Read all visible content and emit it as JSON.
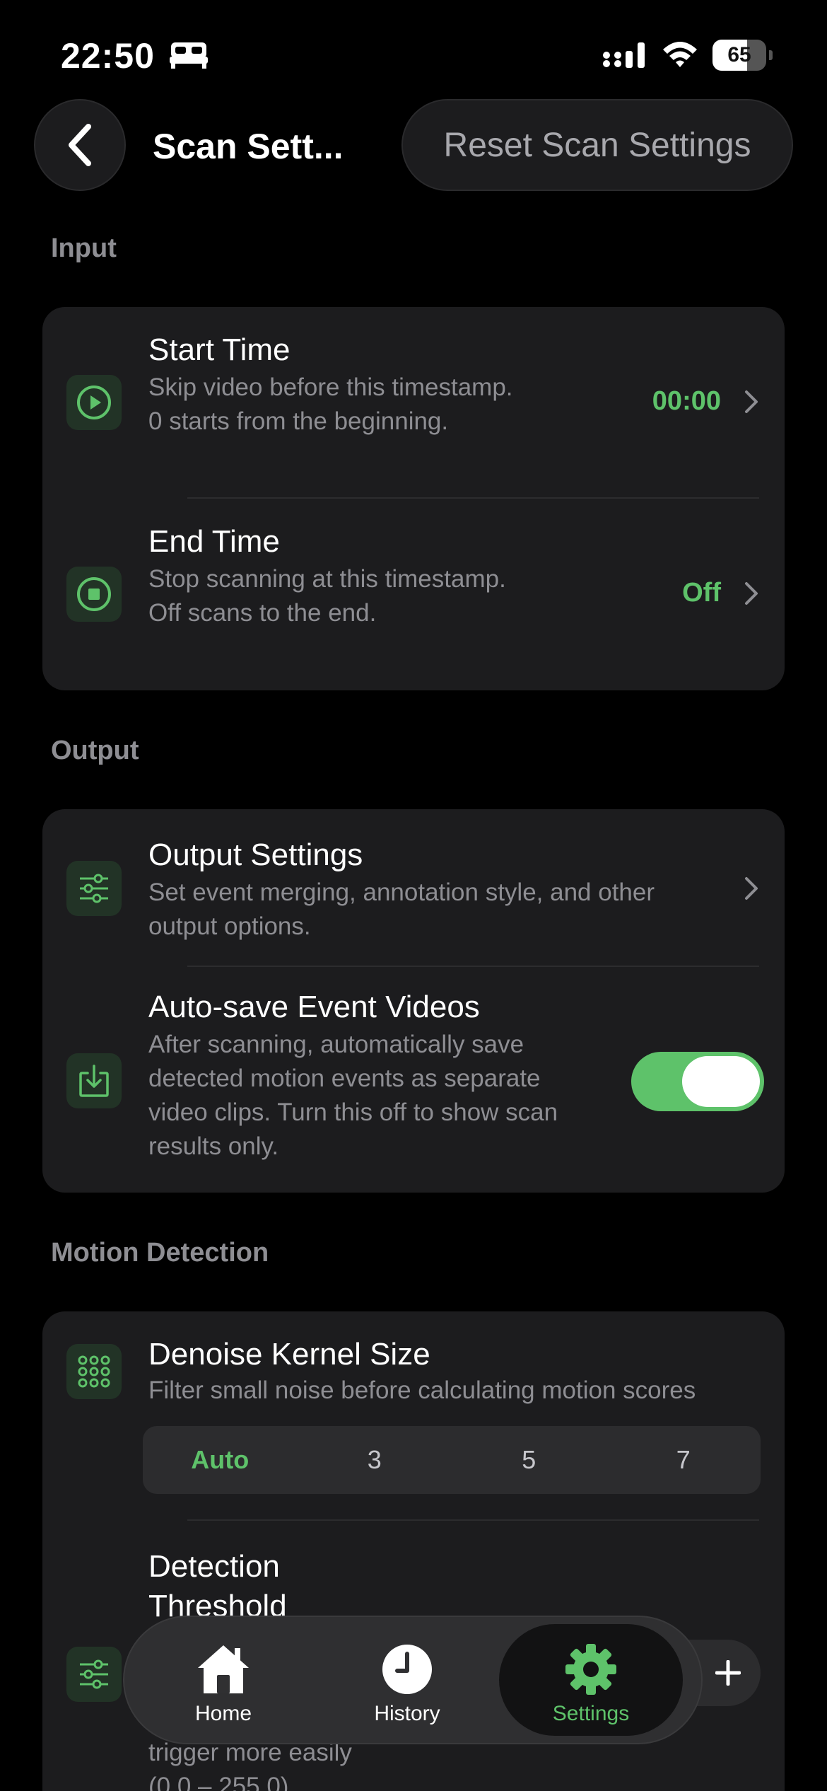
{
  "status_bar": {
    "time": "22:50",
    "battery_level": "65",
    "battery_percent": 65
  },
  "nav": {
    "title": "Scan Sett...",
    "reset_label": "Reset Scan Settings"
  },
  "sections": {
    "input": {
      "header": "Input",
      "start_time": {
        "title": "Start Time",
        "description": "Skip video before this timestamp. 0 starts from the beginning.",
        "value": "00:00",
        "icon": "play-circle-icon"
      },
      "end_time": {
        "title": "End Time",
        "description": "Stop scanning at this timestamp. Off scans to the end.",
        "value": "Off",
        "icon": "stop-circle-icon"
      }
    },
    "output": {
      "header": "Output",
      "output_settings": {
        "title": "Output Settings",
        "description": "Set event merging, annotation style, and other output options.",
        "icon": "sliders-icon"
      },
      "auto_save": {
        "title": "Auto-save Event Videos",
        "description": "After scanning, automatically save detected motion events as separate video clips. Turn this off to show scan results only.",
        "enabled": true,
        "icon": "download-tray-icon"
      }
    },
    "motion_detection": {
      "header": "Motion Detection",
      "denoise": {
        "title": "Denoise Kernel Size",
        "description": "Filter small noise before calculating motion scores",
        "options": [
          "Auto",
          "3",
          "5",
          "7"
        ],
        "selected": "Auto",
        "icon": "grid-dots-icon"
      },
      "threshold": {
        "title_line1": "Detection",
        "title_line2": "Threshold",
        "description_line1": "trigger more easily",
        "description_line2": "(0.0 – 255.0)",
        "stepper_plus": "+",
        "icon": "sliders-icon"
      }
    }
  },
  "tab_bar": {
    "tabs": [
      {
        "label": "Home",
        "icon": "house-icon",
        "active": false
      },
      {
        "label": "History",
        "icon": "clock-icon",
        "active": false
      },
      {
        "label": "Settings",
        "icon": "gear-icon",
        "active": true
      }
    ]
  },
  "colors": {
    "accent": "#5ec26a",
    "card": "#1c1c1e",
    "background": "#000000"
  }
}
